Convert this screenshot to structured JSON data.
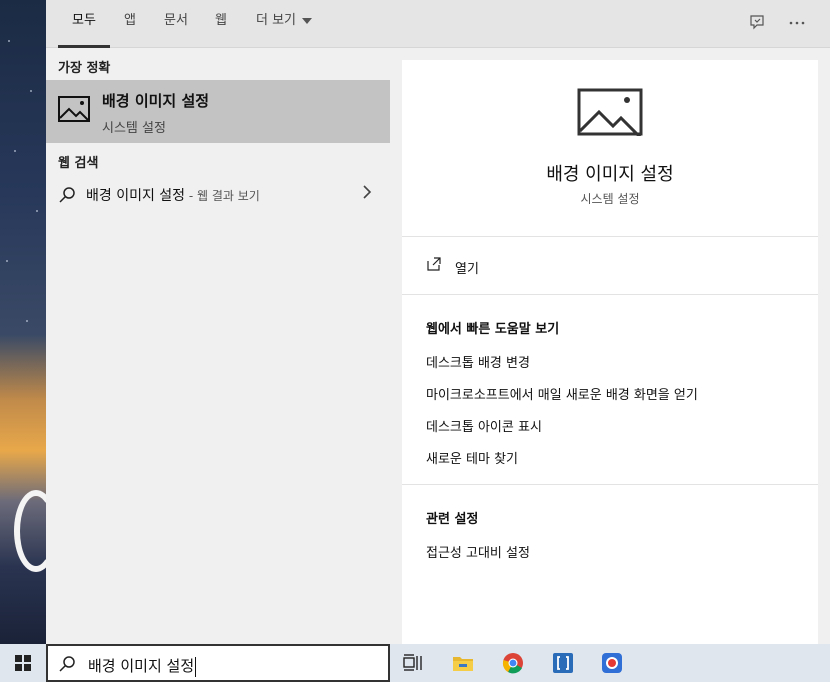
{
  "tabs": [
    {
      "label": "모두",
      "active": true
    },
    {
      "label": "앱"
    },
    {
      "label": "문서"
    },
    {
      "label": "웹"
    },
    {
      "label": "더 보기"
    }
  ],
  "top_icons": [
    "feedback-icon",
    "more-options-icon"
  ],
  "best_match": {
    "section_label": "가장 정확",
    "title": "배경 이미지 설정",
    "subtitle": "시스템 설정",
    "icon": "picture-icon"
  },
  "web_search": {
    "section_label": "웹 검색",
    "query": "배경 이미지 설정",
    "suffix": " - 웹 결과 보기",
    "icon": "search-icon"
  },
  "detail": {
    "title": "배경 이미지 설정",
    "subtitle": "시스템 설정",
    "open_label": "열기",
    "help_title": "웹에서 빠른 도움말 보기",
    "help_links": [
      "데스크톱 배경 변경",
      "마이크로소프트에서 매일 새로운 배경 화면을 얻기",
      "데스크톱 아이콘 표시",
      "새로운 테마 찾기"
    ],
    "related_title": "관련 설정",
    "related_links": [
      "접근성 고대비 설정"
    ]
  },
  "taskbar": {
    "search_text": "배경 이미지 설정",
    "apps": [
      "task-view-icon",
      "file-explorer-icon",
      "chrome-icon",
      "bracket-app-icon",
      "record-app-icon"
    ]
  },
  "colors": {
    "highlight": "#c3c3c3",
    "panel_bg": "#f0f0f0",
    "taskbar_bg": "#dfe6ee"
  }
}
